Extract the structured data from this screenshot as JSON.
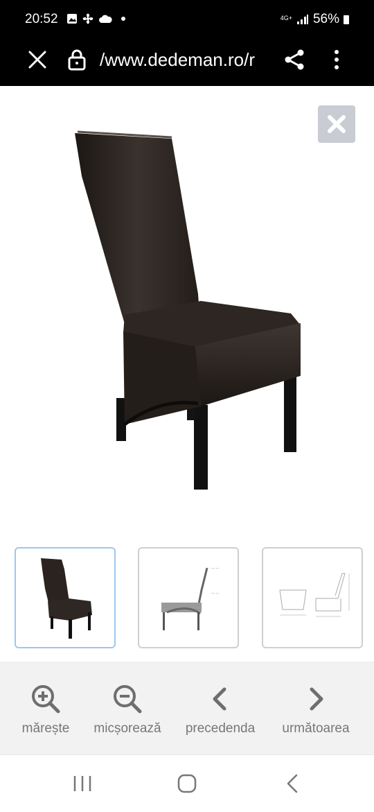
{
  "status_bar": {
    "time": "20:52",
    "network": "4G+",
    "battery": "56%",
    "left_icons": [
      "image-icon",
      "fan-icon",
      "cloud-icon",
      "dot-icon"
    ]
  },
  "browser": {
    "url": "/www.dedeman.ro/r",
    "icons": [
      "close-icon",
      "lock-icon",
      "share-icon",
      "more-vertical-icon"
    ]
  },
  "gallery": {
    "close_icon": "close-icon",
    "main_image": "dark leather high-back dining chair",
    "thumbnails": [
      {
        "name": "photo",
        "active": true
      },
      {
        "name": "side drawing",
        "active": false
      },
      {
        "name": "dimension drawing",
        "active": false
      }
    ]
  },
  "toolbar": {
    "zoom_in_label": "mărește",
    "zoom_out_label": "micșorează",
    "prev_label": "precedenda",
    "next_label": "următoarea"
  },
  "nav": {
    "icons": [
      "recent-apps-icon",
      "home-icon",
      "back-icon"
    ]
  },
  "colors": {
    "status_bg": "#000000",
    "toolbar_bg": "#f2f2f2",
    "toolbar_icon": "#6e6e6e",
    "close_button_bg": "#c9ccd2",
    "active_thumb_border": "#9cc7ee"
  }
}
